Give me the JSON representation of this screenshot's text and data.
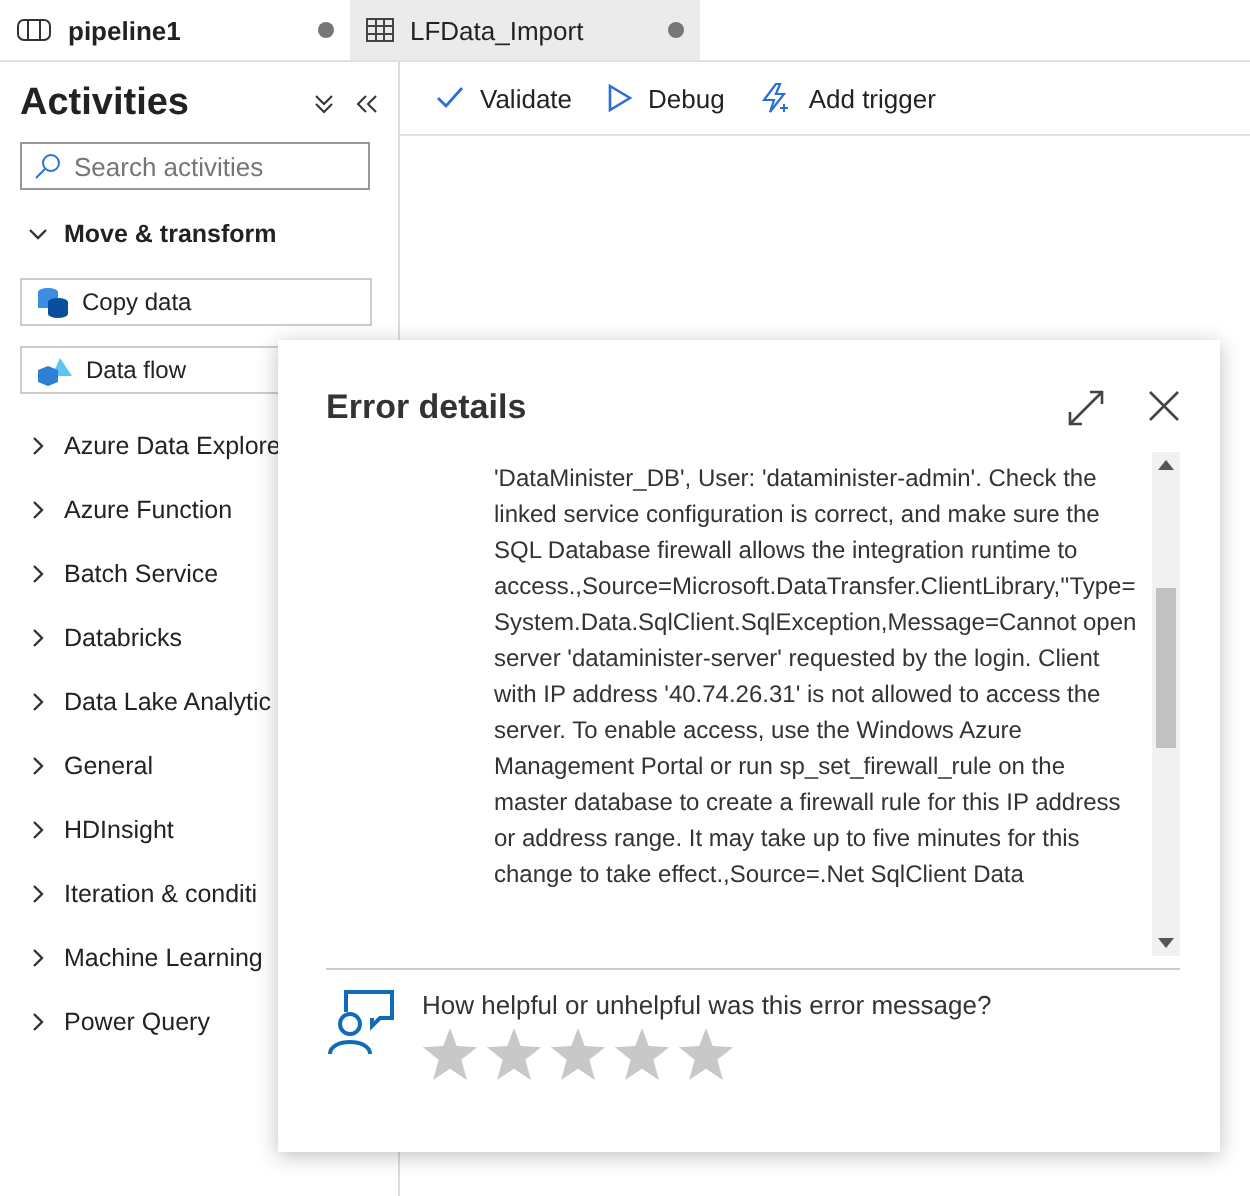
{
  "tabs": [
    {
      "label": "pipeline1",
      "selected": true,
      "unsaved": true,
      "kind": "pipeline"
    },
    {
      "label": "LFData_Import",
      "selected": false,
      "unsaved": true,
      "kind": "dataset"
    }
  ],
  "sidebar": {
    "title": "Activities",
    "search": {
      "placeholder": "Search activities"
    },
    "groups": [
      {
        "label": "Move & transform",
        "expanded": true,
        "items": [
          {
            "label": "Copy data",
            "kind": "copy"
          },
          {
            "label": "Data flow",
            "kind": "flow"
          }
        ]
      },
      {
        "label": "Azure Data Explore",
        "expanded": false
      },
      {
        "label": "Azure Function",
        "expanded": false
      },
      {
        "label": "Batch Service",
        "expanded": false
      },
      {
        "label": "Databricks",
        "expanded": false
      },
      {
        "label": "Data Lake Analytic",
        "expanded": false
      },
      {
        "label": "General",
        "expanded": false
      },
      {
        "label": "HDInsight",
        "expanded": false
      },
      {
        "label": "Iteration & conditi",
        "expanded": false
      },
      {
        "label": "Machine Learning",
        "expanded": false
      },
      {
        "label": "Power Query",
        "expanded": false
      }
    ]
  },
  "toolbar": [
    {
      "label": "Validate",
      "kind": "check"
    },
    {
      "label": "Debug",
      "kind": "play"
    },
    {
      "label": "Add trigger",
      "kind": "trigger"
    }
  ],
  "dialog": {
    "title": "Error details",
    "message": "'DataMinister_DB', User: 'dataminister-admin'. Check the linked service configuration is correct, and make sure the SQL Database firewall allows the integration runtime to access.,Source=Microsoft.DataTransfer.ClientLibrary,''Type=System.Data.SqlClient.SqlException,Message=Cannot open server 'dataminister-server' requested by the login. Client with IP address '40.74.26.31' is not allowed to access the server. To enable access, use the Windows Azure Management Portal or run sp_set_firewall_rule on the master database to create a firewall rule for this IP address or address range. It may take up to five minutes for this change to take effect.,Source=.Net SqlClient Data",
    "feedback": {
      "question": "How helpful or unhelpful was this error message?",
      "stars": 0
    }
  }
}
